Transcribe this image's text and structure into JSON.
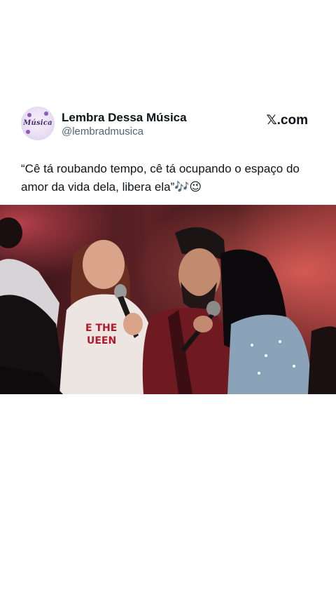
{
  "post": {
    "display_name": "Lembra Dessa Música",
    "handle": "@lembradmusica",
    "brand": "𝕏.com",
    "avatar_label": "Música",
    "text": "“Cê tá roubando tempo, cê tá ocupando o espaço do amor da vida dela, libera ela”🎶😉"
  },
  "media": {
    "shirt_text_line1": "E THE",
    "shirt_text_line2": "UEEN"
  },
  "colors": {
    "text_primary": "#0f1419",
    "text_secondary": "#536471",
    "background": "#ffffff"
  }
}
